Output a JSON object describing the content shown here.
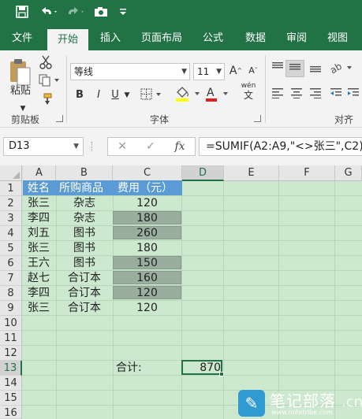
{
  "qat": {
    "icons": [
      "save-icon",
      "undo-icon",
      "redo-icon",
      "camera-icon",
      "customize-icon"
    ]
  },
  "tabs": [
    "文件",
    "开始",
    "插入",
    "页面布局",
    "公式",
    "数据",
    "审阅",
    "视图"
  ],
  "ribbon": {
    "paste_label": "粘贴",
    "clipboard_label": "剪贴板",
    "font_name": "等线",
    "font_size": "11",
    "bold": "B",
    "italic": "I",
    "underline": "U",
    "grow_font": "A",
    "shrink_font": "A",
    "pinyin_top": "wén",
    "pinyin_bottom": "文",
    "font_group_label": "字体",
    "align_group_label": "对齐方",
    "font_color": "#e02020"
  },
  "formula_bar": {
    "name_box": "D13",
    "fx": "fx",
    "formula": "=SUMIF(A2:A9,\"<>张三\",C2)"
  },
  "grid": {
    "columns": [
      "A",
      "B",
      "C",
      "D",
      "E",
      "F",
      "G"
    ],
    "rows": [
      "1",
      "2",
      "3",
      "4",
      "5",
      "6",
      "7",
      "8",
      "9",
      "10",
      "11",
      "12",
      "13",
      "14",
      "15",
      "16"
    ],
    "header": [
      "姓名",
      "所购商品",
      "费用（元）"
    ],
    "data": [
      [
        "张三",
        "杂志",
        "120"
      ],
      [
        "李四",
        "杂志",
        "180"
      ],
      [
        "刘五",
        "图书",
        "260"
      ],
      [
        "张三",
        "图书",
        "180"
      ],
      [
        "王六",
        "图书",
        "150"
      ],
      [
        "赵七",
        "合订本",
        "160"
      ],
      [
        "李四",
        "合订本",
        "120"
      ],
      [
        "张三",
        "合订本",
        "120"
      ]
    ],
    "total_label": "合计:",
    "total_value": "870"
  },
  "watermark": {
    "title": "笔记部落",
    "url": "www.notetribe.com",
    "suffix": ".cn"
  },
  "colors": {
    "accent": "#217346",
    "header_fill": "#5b9bd5",
    "highlight_fill": "#9aae9e",
    "sheet_bg": "#cce8cf"
  }
}
